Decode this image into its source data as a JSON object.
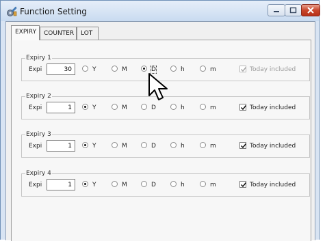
{
  "window": {
    "title": "Function Setting",
    "icon": "settings-app-icon"
  },
  "tabs": [
    {
      "label": "EXPIRY",
      "active": true
    },
    {
      "label": "COUNTER",
      "active": false
    },
    {
      "label": "LOT",
      "active": false
    }
  ],
  "groups": [
    {
      "label": "Expiry 1",
      "field_label": "Expi",
      "value": "30",
      "options": [
        "Y",
        "M",
        "D",
        "h",
        "m"
      ],
      "selected": "D",
      "today_label": "Today included",
      "today_checked": true,
      "today_disabled": true
    },
    {
      "label": "Expiry 2",
      "field_label": "Expi",
      "value": "1",
      "options": [
        "Y",
        "M",
        "D",
        "h",
        "m"
      ],
      "selected": "Y",
      "today_label": "Today included",
      "today_checked": true,
      "today_disabled": false
    },
    {
      "label": "Expiry 3",
      "field_label": "Expi",
      "value": "1",
      "options": [
        "Y",
        "M",
        "D",
        "h",
        "m"
      ],
      "selected": "Y",
      "today_label": "Today included",
      "today_checked": true,
      "today_disabled": false
    },
    {
      "label": "Expiry 4",
      "field_label": "Expi",
      "value": "1",
      "options": [
        "Y",
        "M",
        "D",
        "h",
        "m"
      ],
      "selected": "Y",
      "today_label": "Today included",
      "today_checked": true,
      "today_disabled": false
    }
  ],
  "colors": {
    "title_bar": "#c9dbf0",
    "close_button": "#c9462c",
    "panel": "#f7f7f7"
  }
}
